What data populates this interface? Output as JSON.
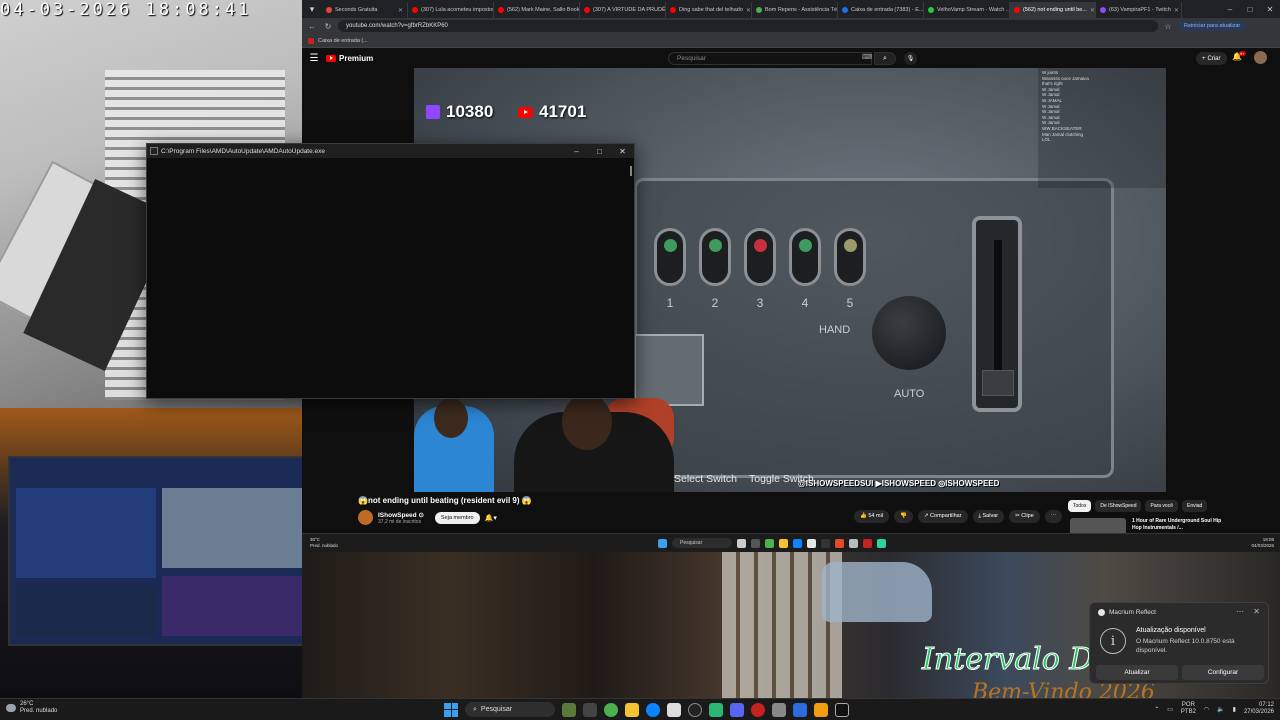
{
  "webcam": {
    "timestamp": "04-03-2026 18:08:41"
  },
  "browser": {
    "tabs": [
      {
        "label": "Seconds Gratuita",
        "color": "#e8453c"
      },
      {
        "label": "(307) Lula acometeu impostor...",
        "color": "#ff0000"
      },
      {
        "label": "(562) Mark Maine, Sallo Book...",
        "color": "#ff0000"
      },
      {
        "label": "(307) A VIRTUDE DA PRUDÊ...",
        "color": "#ff0000"
      },
      {
        "label": "Ding sabe that del telhado",
        "color": "#ff0000"
      },
      {
        "label": "Bom Repens - Assistência Té...",
        "color": "#4caf50"
      },
      {
        "label": "Caixa de entrada (7383) - E...",
        "color": "#1a73e8"
      },
      {
        "label": "VelhoVamp Stream - Watch ...",
        "color": "#27c93f"
      },
      {
        "label": "(562) not ending until be...",
        "color": "#ff0000",
        "active": true
      },
      {
        "label": "(63) VampiraPF1 - Twitch",
        "color": "#9146ff"
      }
    ],
    "url": "youtube.com/watch?v=gfbrRZbKKP60",
    "update_button": "Reiniciar para atualizar",
    "bookmark": "Caixa de entrada (..."
  },
  "youtube": {
    "logo": "Premium",
    "search_placeholder": "Pesquisar",
    "create_label": "Criar",
    "bell_badge": "9+",
    "video_title": "😱not ending until beating (resident evil 9) 😱",
    "channel_name": "IShowSpeed ⊙",
    "channel_subs": "37,2 mi de inscritos",
    "join_label": "Seja membro",
    "actions": [
      "👍 54 mil",
      "👎",
      "↗ Compartilhar",
      "⤓ Salvar",
      "✂ Clipe",
      "⋯"
    ],
    "chips": [
      "Todos",
      "De IShowSpeed",
      "Para você",
      "Enviad"
    ],
    "recommended": {
      "title": "1 Hour of Rare Underground Soul Hip Hop Instrumentals /..."
    }
  },
  "stream": {
    "twitch_count": "10380",
    "youtube_count": "41701",
    "switch_numbers": [
      "1",
      "2",
      "3",
      "4",
      "5"
    ],
    "switch_leds": [
      "#3e9a5e",
      "#3e9a5e",
      "#c83040",
      "#3e9a5e",
      "#9a9a6a"
    ],
    "hand_label": "HAND",
    "auto_label": "AUTO",
    "hud": [
      "Select Switch",
      "Toggle Switch"
    ],
    "socials": "@ISHOWSPEEDSUI ▶ISHOWSPEED ◎ISHOWSPEED",
    "chat": [
      {
        "user": "",
        "msg": "W joints"
      },
      {
        "user": "",
        "msg": "Wasssss ooce Jamaica"
      },
      {
        "user": "",
        "msg": "that's right"
      },
      {
        "user": "",
        "msg": "W Jamal"
      },
      {
        "user": "",
        "msg": "W Jamal"
      },
      {
        "user": "",
        "msg": "W JAMAL"
      },
      {
        "user": "",
        "msg": "W Jamal"
      },
      {
        "user": "",
        "msg": "W Jamal"
      },
      {
        "user": "",
        "msg": "W Jamal"
      },
      {
        "user": "",
        "msg": "W Jamal"
      },
      {
        "user": "",
        "msg": "WW BACKSEATER"
      },
      {
        "user": "",
        "msg": "Man Jamal clutching"
      },
      {
        "user": "",
        "msg": "LOL"
      }
    ]
  },
  "cmd": {
    "title": "C:\\Program Files\\AMD\\AutoUpdate\\AMDAutoUpdate.exe"
  },
  "inner_taskbar": {
    "weather": "30°C",
    "weather_desc": "Pred. nublado",
    "search": "Pesquisar",
    "time": "18:08",
    "date": "04/03/2026"
  },
  "room": {
    "overlay_line1": "Intervalo De",
    "overlay_line2": "Bem-Vindo 2026"
  },
  "notification": {
    "app": "Macrium Reflect",
    "title": "Atualização disponível",
    "body": "O Macrium Reflect 10.0.8750 está disponível.",
    "action_update": "Atualizar",
    "action_config": "Configurar"
  },
  "taskbar": {
    "weather_temp": "26°C",
    "weather_desc": "Pred. nublado",
    "search": "Pesquisar",
    "lang1": "POR",
    "lang2": "PTB2",
    "time": "07:12",
    "date": "27/03/2026"
  }
}
